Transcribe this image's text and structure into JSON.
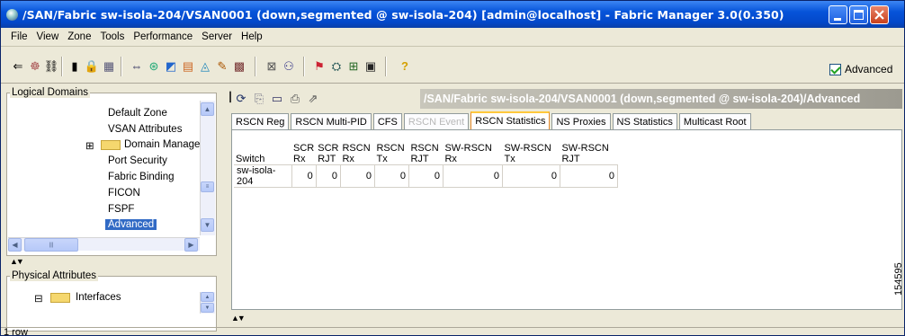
{
  "window": {
    "title": "/SAN/Fabric sw-isola-204/VSAN0001 (down,segmented @ sw-isola-204) [admin@localhost] - Fabric Manager 3.0(0.350)"
  },
  "menu": [
    "File",
    "View",
    "Zone",
    "Tools",
    "Performance",
    "Server",
    "Help"
  ],
  "toolbar": {
    "advanced_label": "Advanced",
    "advanced_checked": true
  },
  "logical_domains": {
    "legend": "Logical Domains",
    "items": [
      {
        "label": "Default Zone"
      },
      {
        "label": "VSAN Attributes"
      },
      {
        "label": "Domain Manage"
      },
      {
        "label": "Port Security"
      },
      {
        "label": "Fabric Binding"
      },
      {
        "label": "FICON"
      },
      {
        "label": "FSPF"
      },
      {
        "label": "Advanced"
      }
    ]
  },
  "physical_attributes": {
    "legend": "Physical Attributes",
    "items": [
      {
        "label": "Interfaces"
      }
    ]
  },
  "content": {
    "path_title": "/SAN/Fabric sw-isola-204/VSAN0001 (down,segmented @ sw-isola-204)/Advanced",
    "tabs": [
      {
        "label": "RSCN Reg",
        "state": "normal"
      },
      {
        "label": "RSCN Multi-PID",
        "state": "normal"
      },
      {
        "label": "CFS",
        "state": "normal"
      },
      {
        "label": "RSCN Event",
        "state": "disabled"
      },
      {
        "label": "RSCN Statistics",
        "state": "active"
      },
      {
        "label": "NS Proxies",
        "state": "normal"
      },
      {
        "label": "NS Statistics",
        "state": "normal"
      },
      {
        "label": "Multicast Root",
        "state": "normal"
      }
    ],
    "table": {
      "headers": [
        [
          "",
          "Switch"
        ],
        [
          "SCR",
          "Rx"
        ],
        [
          "SCR",
          "RJT"
        ],
        [
          "RSCN",
          "Rx"
        ],
        [
          "RSCN",
          "Tx"
        ],
        [
          "RSCN",
          "RJT"
        ],
        [
          "SW-RSCN",
          "Rx"
        ],
        [
          "SW-RSCN",
          "Tx"
        ],
        [
          "SW-RSCN",
          "RJT"
        ]
      ],
      "rows": [
        [
          "sw-isola-204",
          "0",
          "0",
          "0",
          "0",
          "0",
          "0",
          "0",
          "0"
        ]
      ]
    }
  },
  "status": {
    "text": "1 row"
  },
  "figure_id": "154595"
}
